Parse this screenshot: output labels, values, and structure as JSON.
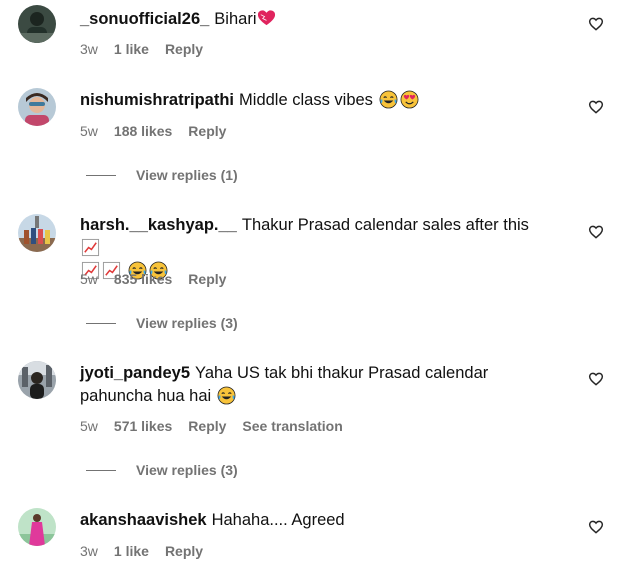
{
  "comments": [
    {
      "username": "_sonuofficial26_",
      "text": "Bihari",
      "time": "3w",
      "likes": "1 like",
      "reply": "Reply"
    },
    {
      "username": "nishumishratripathi",
      "text": "Middle class vibes",
      "time": "5w",
      "likes": "188 likes",
      "reply": "Reply",
      "view_replies": "View replies (1)"
    },
    {
      "username": "harsh.__kashyap.__",
      "text": "Thakur Prasad calendar sales after this",
      "time": "5w",
      "likes": "835 likes",
      "reply": "Reply",
      "view_replies": "View replies (3)"
    },
    {
      "username": "jyoti_pandey5",
      "text": "Yaha US tak bhi thakur Prasad calendar pahuncha hua hai",
      "time": "5w",
      "likes": "571 likes",
      "reply": "Reply",
      "translate": "See translation",
      "view_replies": "View replies (3)"
    },
    {
      "username": "akanshaavishek",
      "text": "Hahaha.... Agreed",
      "time": "3w",
      "likes": "1 like",
      "reply": "Reply"
    }
  ],
  "icons": {
    "like": "heart-outline-icon",
    "heart_emoji": "red-heart-emoji",
    "laugh_emoji": "tears-of-joy-emoji",
    "love_emoji": "heart-eyes-emoji",
    "chart_emoji": "chart-increasing-emoji"
  },
  "colors": {
    "meta_text": "#737373",
    "heart_red": "#e0245e"
  }
}
